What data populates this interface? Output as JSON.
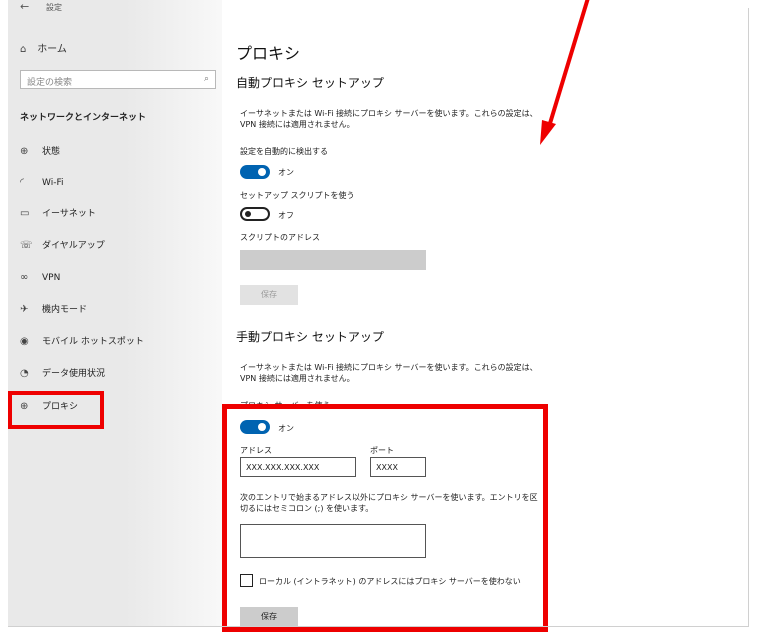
{
  "window": {
    "back": "←",
    "title": "設定"
  },
  "sidebar": {
    "home_label": "ホーム",
    "search_placeholder": "設定の検索",
    "section_title": "ネットワークとインターネット",
    "items": [
      {
        "label": "状態",
        "icon": "globe-status-icon"
      },
      {
        "label": "Wi-Fi",
        "icon": "wifi-icon"
      },
      {
        "label": "イーサネット",
        "icon": "ethernet-icon"
      },
      {
        "label": "ダイヤルアップ",
        "icon": "dialup-icon"
      },
      {
        "label": "VPN",
        "icon": "vpn-icon"
      },
      {
        "label": "機内モード",
        "icon": "airplane-icon"
      },
      {
        "label": "モバイル ホットスポット",
        "icon": "hotspot-icon"
      },
      {
        "label": "データ使用状況",
        "icon": "data-usage-icon"
      },
      {
        "label": "プロキシ",
        "icon": "proxy-globe-icon",
        "selected": true
      }
    ]
  },
  "main": {
    "title": "プロキシ",
    "auto": {
      "heading": "自動プロキシ セットアップ",
      "description": "イーサネットまたは Wi-Fi 接続にプロキシ サーバーを使います。これらの設定は、VPN 接続には適用されません。",
      "detect_label": "設定を自動的に検出する",
      "detect_state": "オン",
      "script_label": "セットアップ スクリプトを使う",
      "script_state": "オフ",
      "address_label": "スクリプトのアドレス",
      "address_value": "",
      "save": "保存"
    },
    "manual": {
      "heading": "手動プロキシ セットアップ",
      "description": "イーサネットまたは Wi-Fi 接続にプロキシ サーバーを使います。これらの設定は、VPN 接続には適用されません。",
      "use_proxy_label": "プロキシ サーバーを使う",
      "use_proxy_state": "オン",
      "address_label": "アドレス",
      "address_value": "XXX.XXX.XXX.XXX",
      "port_label": "ポート",
      "port_value": "XXXX",
      "exceptions_label": "次のエントリで始まるアドレス以外にプロキシ サーバーを使います。エントリを区切るにはセミコロン (;) を使います。",
      "exceptions_value": "",
      "local_checkbox_label": "ローカル (イントラネット) のアドレスにはプロキシ サーバーを使わない",
      "local_checked": false,
      "save": "保存"
    }
  },
  "annotations": {
    "color": "#ee0000"
  }
}
